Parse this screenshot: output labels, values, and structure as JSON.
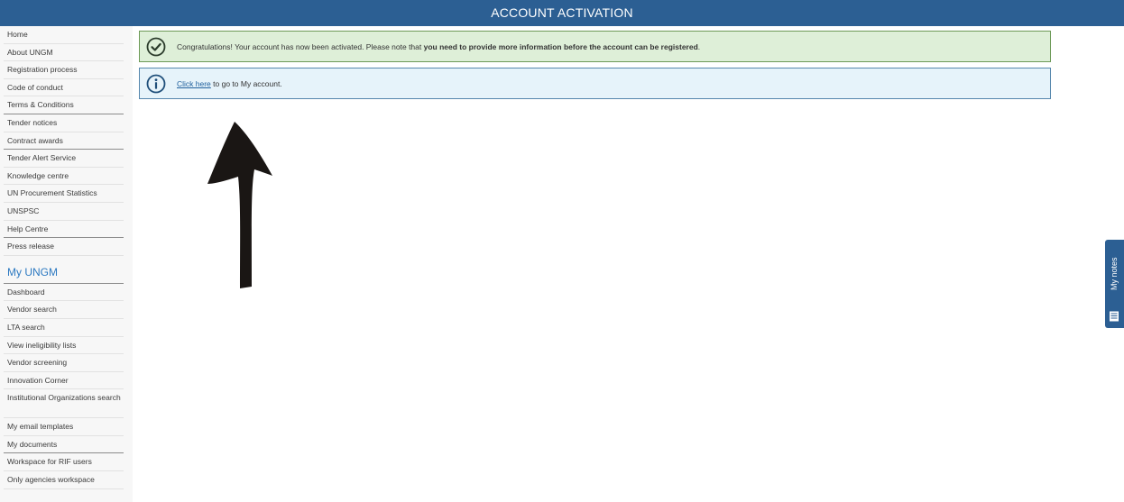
{
  "header": {
    "title": "ACCOUNT ACTIVATION"
  },
  "sidebar": {
    "public_items": [
      {
        "label": "Home",
        "group_end": false
      },
      {
        "label": "About UNGM",
        "group_end": false
      },
      {
        "label": "Registration process",
        "group_end": false
      },
      {
        "label": "Code of conduct",
        "group_end": false
      },
      {
        "label": "Terms & Conditions",
        "group_end": true
      },
      {
        "label": "Tender notices",
        "group_end": false
      },
      {
        "label": "Contract awards",
        "group_end": true
      },
      {
        "label": "Tender Alert Service",
        "group_end": false
      },
      {
        "label": "Knowledge centre",
        "group_end": false
      },
      {
        "label": "UN Procurement Statistics",
        "group_end": false
      },
      {
        "label": "UNSPSC",
        "group_end": false
      },
      {
        "label": "Help Centre",
        "group_end": true
      },
      {
        "label": "Press release",
        "group_end": false
      }
    ],
    "my_section_title": "My UNGM",
    "my_items": [
      {
        "label": "Dashboard",
        "group_end": false,
        "tall": false
      },
      {
        "label": "Vendor search",
        "group_end": false,
        "tall": false
      },
      {
        "label": "LTA search",
        "group_end": false,
        "tall": false
      },
      {
        "label": "View ineligibility lists",
        "group_end": false,
        "tall": false
      },
      {
        "label": "Vendor screening",
        "group_end": false,
        "tall": false
      },
      {
        "label": "Innovation Corner",
        "group_end": false,
        "tall": false
      },
      {
        "label": "Institutional Organizations search",
        "group_end": false,
        "tall": true
      },
      {
        "label": "My email templates",
        "group_end": false,
        "tall": false
      },
      {
        "label": "My documents",
        "group_end": true,
        "tall": false
      },
      {
        "label": "Workspace for RIF users",
        "group_end": false,
        "tall": false
      },
      {
        "label": "Only agencies workspace",
        "group_end": false,
        "tall": false
      }
    ]
  },
  "main": {
    "success_alert": {
      "icon": "check-circle-icon",
      "text_before": "Congratulations! Your account has now been activated. Please note that ",
      "text_bold": "you need to provide more information before the account can be registered",
      "text_after": "."
    },
    "info_alert": {
      "icon": "info-circle-icon",
      "link_text": "Click here",
      "text_after": " to go to My account."
    },
    "annotation": {
      "icon": "hand-drawn-arrow-up-icon"
    }
  },
  "notes_tab": {
    "label": "My notes",
    "icon": "notes-list-icon"
  },
  "colors": {
    "header_bg": "#2c5f93",
    "success_bg": "#deefd8",
    "success_border": "#6d9a57",
    "info_bg": "#e6f3fa",
    "info_border": "#5687ad",
    "section_title": "#2c79c1"
  }
}
